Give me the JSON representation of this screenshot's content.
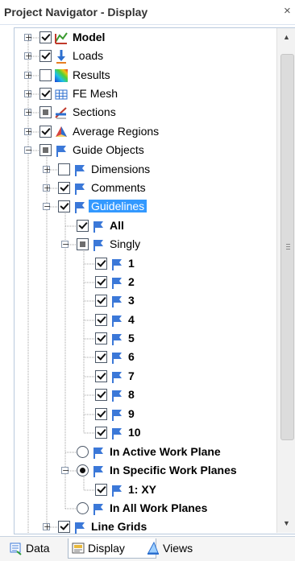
{
  "window": {
    "title": "Project Navigator - Display",
    "close_label": "×"
  },
  "tree": {
    "items": [
      {
        "label": "Model",
        "bold": true,
        "state": "checked",
        "icon": "model-icon",
        "expander": "plus"
      },
      {
        "label": "Loads",
        "state": "checked",
        "icon": "loads-icon",
        "expander": "plus"
      },
      {
        "label": "Results",
        "state": "unchecked",
        "icon": "results-icon",
        "expander": "plus"
      },
      {
        "label": "FE Mesh",
        "state": "checked",
        "icon": "fe-mesh-icon",
        "expander": "plus"
      },
      {
        "label": "Sections",
        "state": "partial",
        "icon": "sections-icon",
        "expander": "plus"
      },
      {
        "label": "Average Regions",
        "state": "checked",
        "icon": "average-regions-icon",
        "expander": "plus"
      },
      {
        "label": "Guide Objects",
        "state": "partial",
        "icon": "guide-icon",
        "expander": "minus"
      },
      {
        "label": "Dimensions",
        "state": "unchecked",
        "icon": "guide-icon",
        "expander": "plus"
      },
      {
        "label": "Comments",
        "state": "checked",
        "icon": "guide-icon",
        "expander": "plus"
      },
      {
        "label": "Guidelines",
        "state": "checked",
        "icon": "guide-icon",
        "expander": "minus",
        "selected": true
      },
      {
        "label": "All",
        "state": "checked",
        "icon": "guide-icon",
        "bold": true
      },
      {
        "label": "Singly",
        "state": "partial",
        "icon": "guide-icon",
        "expander": "minus"
      },
      {
        "label": "1",
        "state": "checked",
        "icon": "guide-icon",
        "bold": true
      },
      {
        "label": "2",
        "state": "checked",
        "icon": "guide-icon",
        "bold": true
      },
      {
        "label": "3",
        "state": "checked",
        "icon": "guide-icon",
        "bold": true
      },
      {
        "label": "4",
        "state": "checked",
        "icon": "guide-icon",
        "bold": true
      },
      {
        "label": "5",
        "state": "checked",
        "icon": "guide-icon",
        "bold": true
      },
      {
        "label": "6",
        "state": "checked",
        "icon": "guide-icon",
        "bold": true
      },
      {
        "label": "7",
        "state": "checked",
        "icon": "guide-icon",
        "bold": true
      },
      {
        "label": "8",
        "state": "checked",
        "icon": "guide-icon",
        "bold": true
      },
      {
        "label": "9",
        "state": "checked",
        "icon": "guide-icon",
        "bold": true
      },
      {
        "label": "10",
        "state": "checked",
        "icon": "guide-icon",
        "bold": true
      },
      {
        "label": "In Active Work Plane",
        "state": "radio",
        "icon": "guide-icon",
        "bold": true
      },
      {
        "label": "In Specific Work Planes",
        "state": "radio-selected",
        "icon": "guide-icon",
        "bold": true,
        "expander": "minus"
      },
      {
        "label": "1: XY",
        "state": "checked",
        "icon": "guide-icon",
        "bold": true
      },
      {
        "label": "In All Work Planes",
        "state": "radio",
        "icon": "guide-icon",
        "bold": true
      },
      {
        "label": "Line Grids",
        "state": "checked",
        "icon": "guide-icon",
        "bold": true,
        "expander": "plus"
      }
    ]
  },
  "tabs": [
    {
      "label": "Data",
      "icon": "data-icon",
      "active": false
    },
    {
      "label": "Display",
      "icon": "display-icon",
      "active": true
    },
    {
      "label": "Views",
      "icon": "views-icon",
      "active": false
    }
  ],
  "colors": {
    "selection": "#3399ff",
    "guide_icon": "#3b78d8",
    "tree_line": "#a0a0a0"
  }
}
